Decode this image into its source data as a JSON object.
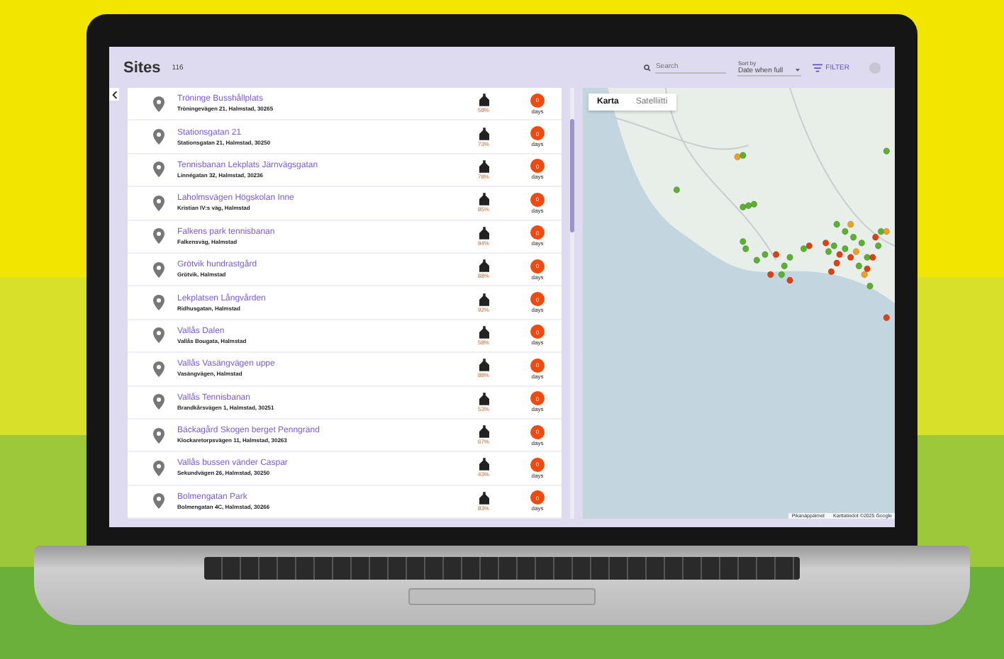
{
  "header": {
    "title": "Sites",
    "count": "116",
    "search": {
      "placeholder": "Search"
    },
    "sort": {
      "label": "Sort by",
      "value": "Date when full"
    },
    "filter": "FILTER"
  },
  "sites": [
    {
      "name": "Tröninge Busshållplats",
      "address": "Tröningevägen 21, Halmstad, 30265",
      "fill": "58%",
      "days": "0",
      "unit": "days"
    },
    {
      "name": "Stationsgatan 21",
      "address": "Stationsgatan 21, Halmstad, 30250",
      "fill": "73%",
      "days": "0",
      "unit": "days"
    },
    {
      "name": "Tennisbanan Lekplats Järnvägsgatan",
      "address": "Linnégatan 32, Halmstad, 30236",
      "fill": "78%",
      "days": "0",
      "unit": "days"
    },
    {
      "name": "Laholmsvägen Högskolan Inne",
      "address": "Kristian IV:s väg, Halmstad",
      "fill": "85%",
      "days": "0",
      "unit": "days"
    },
    {
      "name": "Falkens park tennisbanan",
      "address": "Falkensväg, Halmstad",
      "fill": "94%",
      "days": "0",
      "unit": "days"
    },
    {
      "name": "Grötvik hundrastgård",
      "address": "Grötvik, Halmstad",
      "fill": "88%",
      "days": "0",
      "unit": "days"
    },
    {
      "name": "Lekplatsen Långvården",
      "address": "Ridhusgatan, Halmstad",
      "fill": "92%",
      "days": "0",
      "unit": "days"
    },
    {
      "name": "Vallås Dalen",
      "address": "Vallås Bougata, Halmstad",
      "fill": "58%",
      "days": "0",
      "unit": "days"
    },
    {
      "name": "Vallås Vasängvägen uppe",
      "address": "Vasängvägen, Halmstad",
      "fill": "88%",
      "days": "0",
      "unit": "days"
    },
    {
      "name": "Vallås Tennisbanan",
      "address": "Brandkårsvägen 1, Halmstad, 30251",
      "fill": "53%",
      "days": "0",
      "unit": "days"
    },
    {
      "name": "Bäckagård Skogen berget Penngränd",
      "address": "Klockaretorpsvägen 11, Halmstad, 30263",
      "fill": "67%",
      "days": "0",
      "unit": "days"
    },
    {
      "name": "Vallås bussen vänder Caspar",
      "address": "Sekundvägen 26, Halmstad, 30250",
      "fill": "43%",
      "days": "0",
      "unit": "days"
    },
    {
      "name": "Bolmengatan Park",
      "address": "Bolmengatan 4C, Halmstad, 30266",
      "fill": "83%",
      "days": "0",
      "unit": "days"
    }
  ],
  "map": {
    "tabs": [
      {
        "label": "Karta",
        "selected": true
      },
      {
        "label": "Satelliitti",
        "selected": false
      }
    ],
    "attribution": [
      "Pikanäppäimet",
      "Karttatiedot ©2025 Google"
    ]
  }
}
